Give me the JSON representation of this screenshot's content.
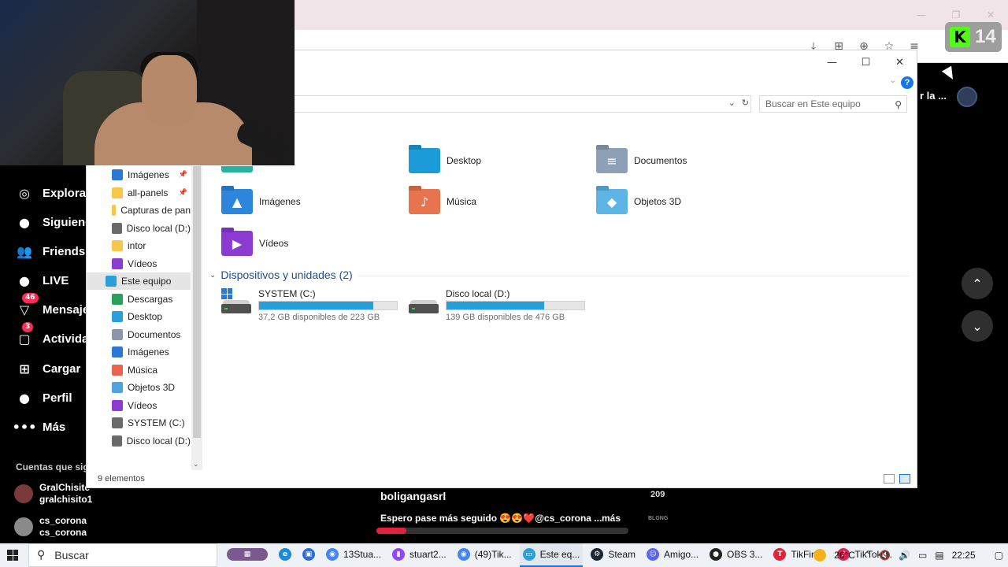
{
  "browser": {
    "window_controls": [
      "—",
      "❐",
      "✕"
    ],
    "toolbar_icons": [
      "⤓",
      "⊞",
      "⊕",
      "☆",
      "≡"
    ],
    "kick_badge": {
      "letter": "K",
      "count": "14"
    }
  },
  "tiktok": {
    "sidebar": [
      {
        "label": "Explorar",
        "icon": "compass-icon",
        "glyph": "◎"
      },
      {
        "label": "Siguiendo",
        "icon": "following-avatar-icon",
        "glyph": "●"
      },
      {
        "label": "Friends",
        "icon": "friends-icon",
        "glyph": "👥"
      },
      {
        "label": "LIVE",
        "icon": "live-icon",
        "glyph": "●"
      },
      {
        "label": "Mensajes",
        "icon": "messages-icon",
        "glyph": "▽",
        "badge": "46"
      },
      {
        "label": "Actividad",
        "icon": "activity-icon",
        "glyph": "▢",
        "badge": "3"
      },
      {
        "label": "Cargar",
        "icon": "upload-icon",
        "glyph": "⊞"
      },
      {
        "label": "Perfil",
        "icon": "profile-icon",
        "glyph": "●"
      },
      {
        "label": "Más",
        "icon": "more-icon",
        "glyph": "•••"
      }
    ],
    "accounts_title": "Cuentas que sig",
    "accounts": [
      {
        "name": "GralChisite",
        "handle": "gralchisito1"
      },
      {
        "name": "cs_corona",
        "handle": "cs_corona"
      }
    ],
    "right_label": "r la ...",
    "nav_up": "⌃",
    "nav_down": "⌄",
    "comment": {
      "user": "boligangasrl",
      "count": "209",
      "text": "Espero pase más seguido 😍😍❤️@cs_corona ...",
      "more": "más",
      "tag": "BLGNG"
    },
    "progress_pct": 12
  },
  "explorer": {
    "window_controls": [
      "—",
      "☐",
      "✕"
    ],
    "help": "?",
    "search_placeholder": "Buscar en Este equipo",
    "nav_items": [
      {
        "label": "Imágenes",
        "icon": "pictures-icon",
        "color": "#2b79d6",
        "pinned": true
      },
      {
        "label": "all-panels",
        "icon": "folder-icon",
        "color": "#f8c74a",
        "pinned": true
      },
      {
        "label": "Capturas de pan",
        "icon": "folder-icon",
        "color": "#f8c74a",
        "pinned": false
      },
      {
        "label": "Disco local (D:)",
        "icon": "drive-icon",
        "color": "#6a6a6a",
        "pinned": false
      },
      {
        "label": "intor",
        "icon": "folder-icon",
        "color": "#f8c74a",
        "pinned": false
      },
      {
        "label": "Vídeos",
        "icon": "videos-icon",
        "color": "#8b3bd1",
        "pinned": false
      },
      {
        "label": "Este equipo",
        "icon": "this-pc-icon",
        "color": "#2aa0d8",
        "pinned": false,
        "selected": true
      },
      {
        "label": "Descargas",
        "icon": "downloads-icon",
        "color": "#2aa05a",
        "pinned": false
      },
      {
        "label": "Desktop",
        "icon": "desktop-icon",
        "color": "#2aa0d8",
        "pinned": false
      },
      {
        "label": "Documentos",
        "icon": "documents-icon",
        "color": "#8a97a8",
        "pinned": false
      },
      {
        "label": "Imágenes",
        "icon": "pictures-icon",
        "color": "#2b79d6",
        "pinned": false
      },
      {
        "label": "Música",
        "icon": "music-icon",
        "color": "#e8644a",
        "pinned": false
      },
      {
        "label": "Objetos 3D",
        "icon": "3d-objects-icon",
        "color": "#4fa3e0",
        "pinned": false
      },
      {
        "label": "Vídeos",
        "icon": "videos-icon",
        "color": "#8b3bd1",
        "pinned": false
      },
      {
        "label": "SYSTEM (C:)",
        "icon": "drive-icon",
        "color": "#6a6a6a",
        "pinned": false
      },
      {
        "label": "Disco local (D:)",
        "icon": "drive-icon",
        "color": "#6a6a6a",
        "pinned": false
      }
    ],
    "folders": [
      {
        "label": "Desktop",
        "icon": "desktop-folder-icon",
        "color": "#1b9bd8",
        "glyph": ""
      },
      {
        "label": "Documentos",
        "icon": "documents-folder-icon",
        "color": "#8ea0b5",
        "glyph": "≡"
      },
      {
        "label": "Imágenes",
        "icon": "pictures-folder-icon",
        "color": "#2e86dc",
        "glyph": "▲"
      },
      {
        "label": "Música",
        "icon": "music-folder-icon",
        "color": "#e8734f",
        "glyph": "♪"
      },
      {
        "label": "Objetos 3D",
        "icon": "3d-objects-folder-icon",
        "color": "#5fb4e6",
        "glyph": "◆"
      },
      {
        "label": "Vídeos",
        "icon": "videos-folder-icon",
        "color": "#8b3bd1",
        "glyph": "▶"
      }
    ],
    "group_title": "Dispositivos y unidades (2)",
    "drives": [
      {
        "name": "SYSTEM (C:)",
        "free": "37,2 GB disponibles de 223 GB",
        "used_pct": 83,
        "windows": true
      },
      {
        "name": "Disco local (D:)",
        "free": "139 GB disponibles de 476 GB",
        "used_pct": 71,
        "windows": false
      }
    ],
    "status": "9 elementos"
  },
  "taskbar": {
    "search_label": "Buscar",
    "apps": [
      {
        "label": "",
        "icon": "landscape-widget-icon",
        "color": "#7a5a8e",
        "glyph": "▦"
      },
      {
        "label": "",
        "icon": "edge-icon",
        "color": "#1d8ad8",
        "glyph": "e"
      },
      {
        "label": "",
        "icon": "store-icon",
        "color": "#2b6ed6",
        "glyph": "▣"
      },
      {
        "label": "13Stua...",
        "icon": "chrome-icon",
        "color": "#4285f4",
        "glyph": "◉"
      },
      {
        "label": "stuart2...",
        "icon": "twitch-icon",
        "color": "#9146ff",
        "glyph": "▮"
      },
      {
        "label": "(49)Tik...",
        "icon": "chrome-icon",
        "color": "#4285f4",
        "glyph": "◉"
      },
      {
        "label": "Este eq...",
        "icon": "explorer-icon",
        "color": "#2aa0d8",
        "glyph": "▭",
        "active": true
      },
      {
        "label": "Steam",
        "icon": "steam-icon",
        "color": "#1b2838",
        "glyph": "⚙"
      },
      {
        "label": "Amigo...",
        "icon": "discord-icon",
        "color": "#5865f2",
        "glyph": "☺"
      },
      {
        "label": "OBS 3...",
        "icon": "obs-icon",
        "color": "#222222",
        "glyph": "●"
      },
      {
        "label": "TikFini...",
        "icon": "tikfinity-icon",
        "color": "#e0233b",
        "glyph": "T"
      },
      {
        "label": "TikTok ...",
        "icon": "tiktok-icon",
        "color": "#e0234e",
        "glyph": "♪"
      }
    ],
    "weather": "26°C",
    "tray_icons": [
      "⌃",
      "🔇",
      "🔊",
      "▭",
      "▤"
    ],
    "time": "22:25",
    "notification_glyph": "▢"
  }
}
